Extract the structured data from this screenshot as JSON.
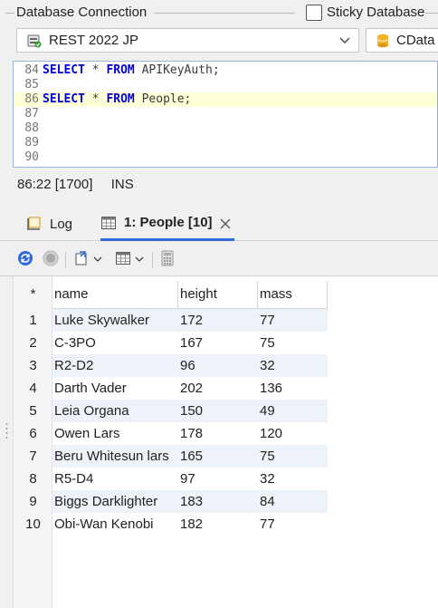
{
  "connection": {
    "group_title": "Database Connection",
    "sticky_label": "Sticky Database",
    "selected": "REST 2022 JP",
    "cdata_label": "CData"
  },
  "editor": {
    "lines": [
      {
        "num": "84",
        "parts": [
          {
            "kw": true,
            "t": "SELECT"
          },
          {
            "kw": false,
            "t": " * "
          },
          {
            "kw": true,
            "t": "FROM"
          },
          {
            "kw": false,
            "t": " APIKeyAuth;"
          }
        ]
      },
      {
        "num": "85",
        "parts": []
      },
      {
        "num": "86",
        "parts": [
          {
            "kw": true,
            "t": "SELECT"
          },
          {
            "kw": false,
            "t": " * "
          },
          {
            "kw": true,
            "t": "FROM"
          },
          {
            "kw": false,
            "t": " People;"
          }
        ]
      },
      {
        "num": "87",
        "parts": []
      },
      {
        "num": "88",
        "parts": []
      },
      {
        "num": "89",
        "parts": []
      },
      {
        "num": "90",
        "parts": []
      }
    ]
  },
  "status": {
    "position": "86:22 [1700]",
    "mode": "INS"
  },
  "tabs": {
    "log": "Log",
    "people": "1: People [10]"
  },
  "grid": {
    "star": "*",
    "columns": [
      "name",
      "height",
      "mass"
    ],
    "rows": [
      {
        "n": "1",
        "name": "Luke Skywalker",
        "height": "172",
        "mass": "77"
      },
      {
        "n": "2",
        "name": "C-3PO",
        "height": "167",
        "mass": "75"
      },
      {
        "n": "3",
        "name": "R2-D2",
        "height": "96",
        "mass": "32"
      },
      {
        "n": "4",
        "name": "Darth Vader",
        "height": "202",
        "mass": "136"
      },
      {
        "n": "5",
        "name": "Leia Organa",
        "height": "150",
        "mass": "49"
      },
      {
        "n": "6",
        "name": "Owen Lars",
        "height": "178",
        "mass": "120"
      },
      {
        "n": "7",
        "name": "Beru Whitesun lars",
        "height": "165",
        "mass": "75"
      },
      {
        "n": "8",
        "name": "R5-D4",
        "height": "97",
        "mass": "32"
      },
      {
        "n": "9",
        "name": "Biggs Darklighter",
        "height": "183",
        "mass": "84"
      },
      {
        "n": "10",
        "name": "Obi-Wan Kenobi",
        "height": "182",
        "mass": "77"
      }
    ]
  },
  "colors": {
    "accent": "#2e6bd8",
    "keyword": "#0000d8",
    "active_line": "#ffffd8",
    "alt_row": "#eef3f9"
  }
}
